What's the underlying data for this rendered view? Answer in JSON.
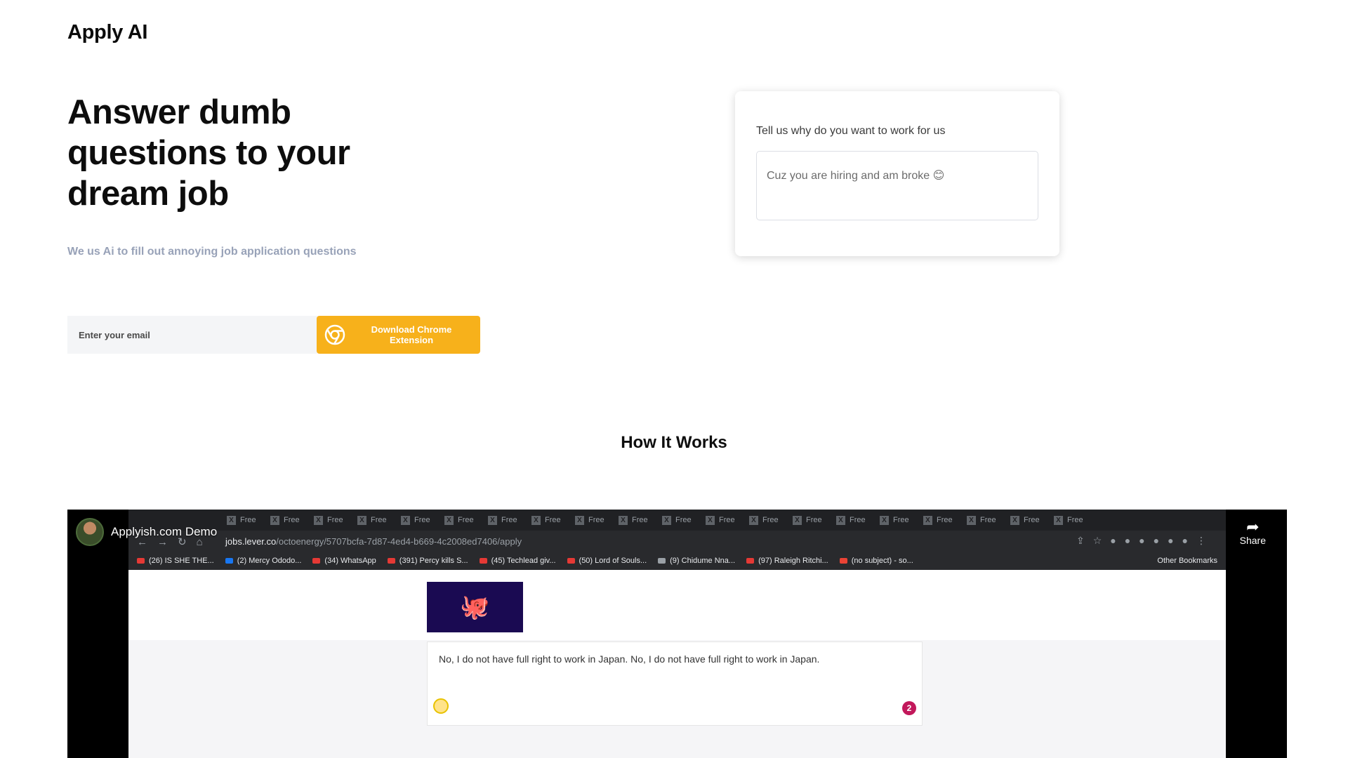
{
  "brand": {
    "logo_text": "Apply AI"
  },
  "hero": {
    "title": "Answer dumb questions to your dream job",
    "subtitle": "We us Ai to fill out annoying job application questions"
  },
  "signup": {
    "email_placeholder": "Enter your email",
    "button_label": "Download Chrome Extension",
    "button_color": "#f7b11b"
  },
  "demo_card": {
    "question": "Tell us why do you want to work for us",
    "answer": "Cuz you are hiring and am broke 😊"
  },
  "how_it_works": {
    "heading": "How It Works"
  },
  "video": {
    "title": "Applyish.com Demo",
    "share_label": "Share",
    "browser": {
      "tabs": [
        "Free",
        "Free",
        "Free",
        "Free",
        "Free",
        "Free",
        "Free",
        "Free",
        "Free",
        "Free",
        "Free",
        "Free",
        "Free",
        "Free",
        "Free",
        "Free",
        "Free",
        "Free",
        "Free",
        "Free"
      ],
      "url_host": "jobs.lever.co",
      "url_path": "/octoenergy/5707bcfa-7d87-4ed4-b669-4c2008ed7406/apply",
      "bookmarks": [
        "(26) IS SHE THE...",
        "(2) Mercy Ododo...",
        "(34) WhatsApp",
        "(391) Percy kills S...",
        "(45) Techlead giv...",
        "(50) Lord of Souls...",
        "(9) Chidume Nna...",
        "(97) Raleigh Ritchi...",
        "(no subject) - so..."
      ],
      "other_bookmarks": "Other Bookmarks"
    },
    "page": {
      "answer_text": "No, I do not have full right to work in Japan. No, I do not have full right to work in Japan.",
      "badge_count": "2"
    }
  }
}
